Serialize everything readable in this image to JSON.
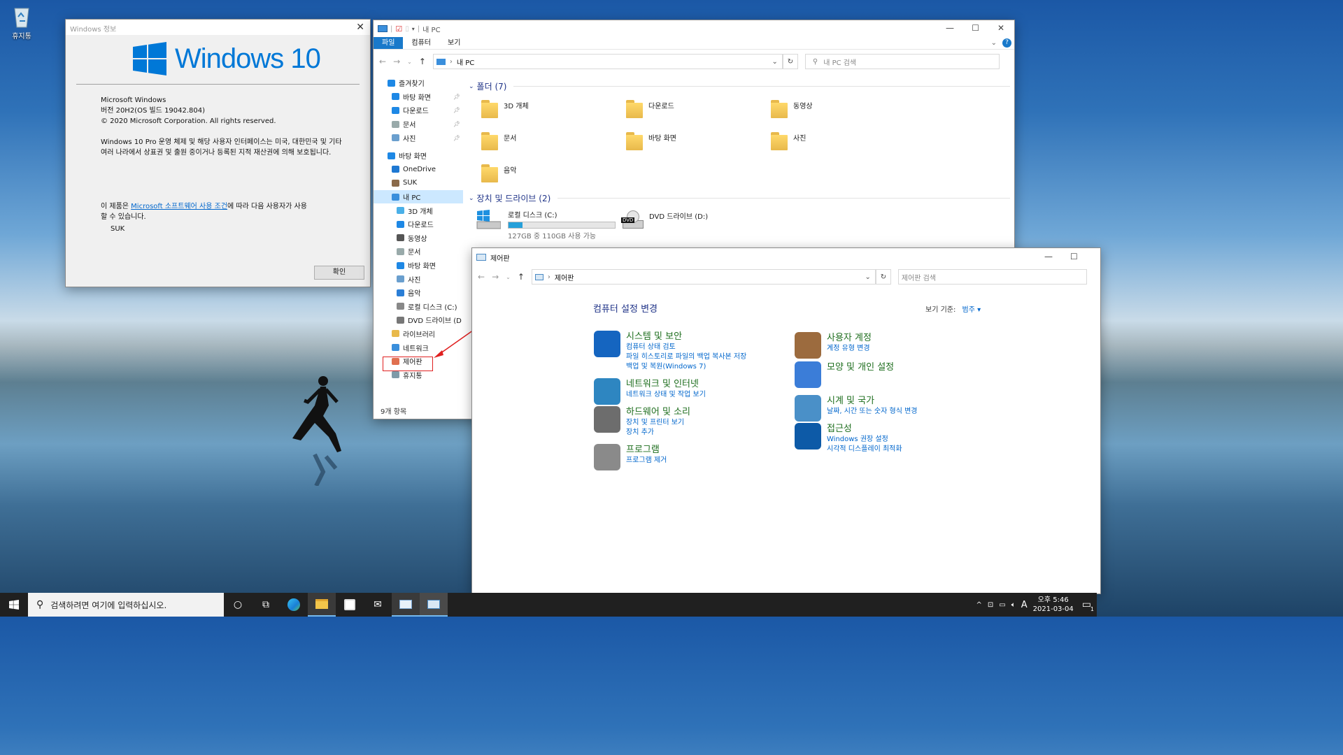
{
  "desktop": {
    "recycle_bin_label": "휴지통"
  },
  "about": {
    "title": "Windows 정보",
    "logo_text": "Windows 10",
    "line1": "Microsoft Windows",
    "line2": "버전 20H2(OS 빌드 19042.804)",
    "line3": "© 2020 Microsoft Corporation. All rights reserved.",
    "para1": "Windows 10 Pro 운영 체제 및 해당 사용자 인터페이스는 미국, 대한민국 및 기타 여러 나라에서 상표권 및 출원 중이거나 등록된 지적 재산권에 의해 보호됩니다.",
    "license_prefix": "이 제품은 ",
    "license_link": "Microsoft 소프트웨어 사용 조건",
    "license_suffix": "에 따라 다음 사용자가 사용할 수 있습니다.",
    "user": "SUK",
    "ok_label": "확인"
  },
  "explorer": {
    "title": "내 PC",
    "ribbon": [
      "파일",
      "컴퓨터",
      "보기"
    ],
    "address": "내 PC",
    "search_placeholder": "내 PC 검색",
    "sidebar": [
      {
        "label": "즐겨찾기",
        "indent": 1,
        "icon": "star-icon"
      },
      {
        "label": "바탕 화면",
        "indent": 2,
        "pinned": true,
        "icon": "desktop-icon"
      },
      {
        "label": "다운로드",
        "indent": 2,
        "pinned": true,
        "icon": "download-icon"
      },
      {
        "label": "문서",
        "indent": 2,
        "pinned": true,
        "icon": "document-icon"
      },
      {
        "label": "사진",
        "indent": 2,
        "pinned": true,
        "icon": "picture-icon"
      },
      {
        "label": "바탕 화면",
        "indent": 1,
        "icon": "desktop-icon"
      },
      {
        "label": "OneDrive",
        "indent": 2,
        "icon": "cloud-icon"
      },
      {
        "label": "SUK",
        "indent": 2,
        "icon": "user-icon"
      },
      {
        "label": "내 PC",
        "indent": 2,
        "selected": true,
        "icon": "computer-icon"
      },
      {
        "label": "3D 개체",
        "indent": 3,
        "icon": "cube-icon"
      },
      {
        "label": "다운로드",
        "indent": 3,
        "icon": "download-icon"
      },
      {
        "label": "동영상",
        "indent": 3,
        "icon": "video-icon"
      },
      {
        "label": "문서",
        "indent": 3,
        "icon": "document-icon"
      },
      {
        "label": "바탕 화면",
        "indent": 3,
        "icon": "desktop-icon"
      },
      {
        "label": "사진",
        "indent": 3,
        "icon": "picture-icon"
      },
      {
        "label": "음악",
        "indent": 3,
        "icon": "music-icon"
      },
      {
        "label": "로컬 디스크 (C:)",
        "indent": 3,
        "icon": "drive-icon"
      },
      {
        "label": "DVD 드라이브 (D",
        "indent": 3,
        "icon": "dvd-icon"
      },
      {
        "label": "라이브러리",
        "indent": 2,
        "icon": "library-icon"
      },
      {
        "label": "네트워크",
        "indent": 2,
        "icon": "network-icon"
      },
      {
        "label": "제어판",
        "indent": 2,
        "icon": "control-panel-icon"
      },
      {
        "label": "휴지통",
        "indent": 2,
        "icon": "recycle-bin-icon"
      }
    ],
    "folders_header": "폴더 (7)",
    "folders": [
      "3D 개체",
      "다운로드",
      "동영상",
      "문서",
      "바탕 화면",
      "사진",
      "음악"
    ],
    "drives_header": "장치 및 드라이브 (2)",
    "drive_c": {
      "name": "로컬 디스크 (C:)",
      "info": "127GB 중 110GB 사용 가능",
      "used_fraction": 0.13
    },
    "drive_d": {
      "name": "DVD 드라이브 (D:)",
      "badge": "DVD"
    },
    "status": "9개 항목"
  },
  "annotation": {
    "text": "ㅎㅎ"
  },
  "control_panel": {
    "title": "제어판",
    "address": "제어판",
    "search_placeholder": "제어판 검색",
    "heading": "컴퓨터 설정 변경",
    "view_by_label": "보기 기준:",
    "view_by_value": "범주",
    "left": [
      {
        "title": "시스템 및 보안",
        "links": [
          "컴퓨터 상태 검토",
          "파일 히스토리로 파일의 백업 복사본 저장",
          "백업 및 복원(Windows 7)"
        ],
        "icon": "shield-icon",
        "color": "#1565c0"
      },
      {
        "title": "네트워크 및 인터넷",
        "links": [
          "네트워크 상태 및 작업 보기"
        ],
        "icon": "globe-icon",
        "color": "#2e86c1"
      },
      {
        "title": "하드웨어 및 소리",
        "links": [
          "장치 및 프린터 보기",
          "장치 추가"
        ],
        "icon": "printer-icon",
        "color": "#6d6d6d"
      },
      {
        "title": "프로그램",
        "links": [
          "프로그램 제거"
        ],
        "icon": "programs-icon",
        "color": "#8a8a8a"
      }
    ],
    "right": [
      {
        "title": "사용자 계정",
        "links": [
          "계정 유형 변경"
        ],
        "icon": "users-icon",
        "color": "#9c6b3e"
      },
      {
        "title": "모양 및 개인 설정",
        "links": [],
        "icon": "personalize-icon",
        "color": "#3b7dd8"
      },
      {
        "title": "시계 및 국가",
        "links": [
          "날짜, 시간 또는 숫자 형식 변경"
        ],
        "icon": "clock-globe-icon",
        "color": "#4a90c8"
      },
      {
        "title": "접근성",
        "links": [
          "Windows 권장 설정",
          "시각적 디스플레이 최적화"
        ],
        "icon": "accessibility-icon",
        "color": "#0d5aa7"
      }
    ]
  },
  "taskbar": {
    "search_placeholder": "검색하려면 여기에 입력하십시오.",
    "time": "오후 5:46",
    "date": "2021-03-04",
    "ime": "A",
    "notification_count": "1"
  }
}
